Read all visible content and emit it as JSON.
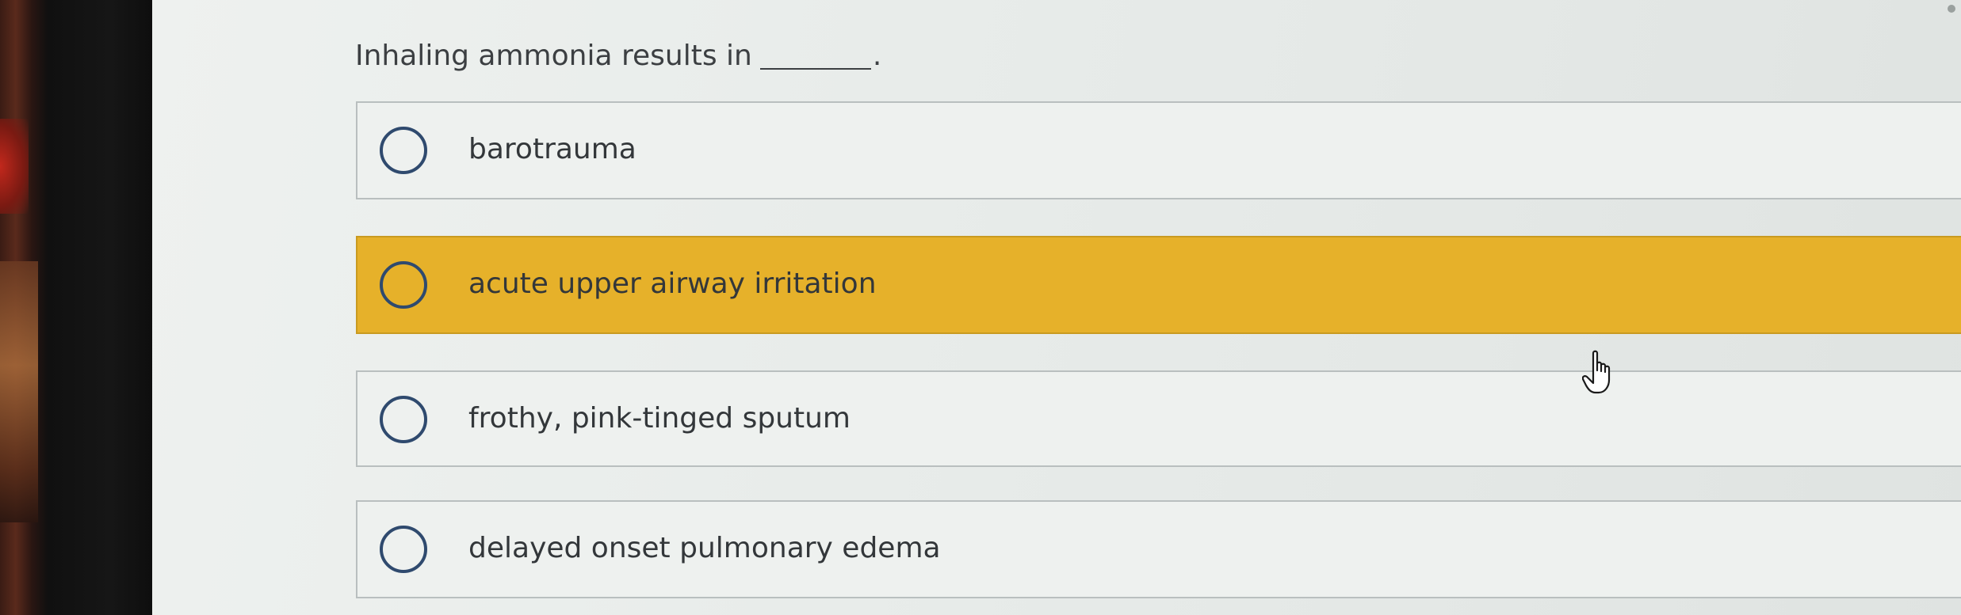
{
  "question": {
    "text": "Inhaling ammonia results in",
    "punctuation": "."
  },
  "options": [
    {
      "label": "barotrauma",
      "highlighted": false
    },
    {
      "label": "acute upper airway irritation",
      "highlighted": true
    },
    {
      "label": "frothy, pink-tinged sputum",
      "highlighted": false
    },
    {
      "label": "delayed onset pulmonary edema",
      "highlighted": false
    }
  ],
  "colors": {
    "highlight": "#e6b12a",
    "radio_border": "#2f4a6e",
    "text": "#33373a",
    "background": "#e9edeb"
  },
  "cursor": {
    "icon": "hand-pointer-icon"
  }
}
